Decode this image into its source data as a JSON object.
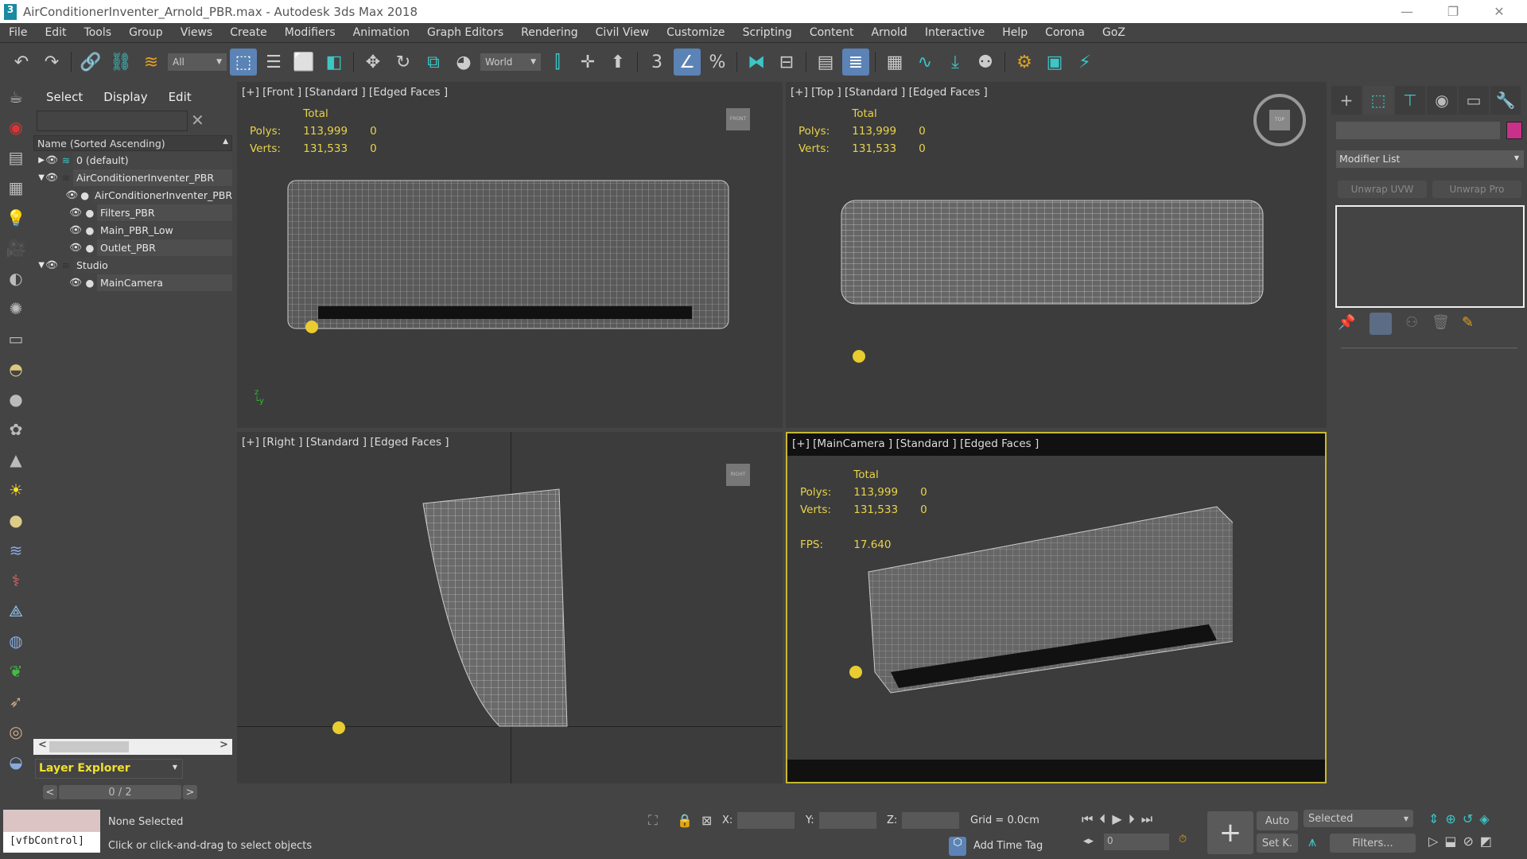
{
  "window": {
    "title": "AirConditionerInventer_Arnold_PBR.max - Autodesk 3ds Max 2018",
    "logo": "3",
    "minimize": "—",
    "restore": "❐",
    "close": "✕"
  },
  "menu": [
    "File",
    "Edit",
    "Tools",
    "Group",
    "Views",
    "Create",
    "Modifiers",
    "Animation",
    "Graph Editors",
    "Rendering",
    "Civil View",
    "Customize",
    "Scripting",
    "Content",
    "Arnold",
    "Interactive",
    "Help",
    "Corona",
    "GoZ"
  ],
  "toolbar": {
    "selection_filter": "All",
    "reference_coord": "World",
    "drop_arrow": "▼"
  },
  "explorer": {
    "tabs": [
      "Select",
      "Display",
      "Edit"
    ],
    "search_value": "",
    "clear": "✕",
    "column_header": "Name (Sorted Ascending)",
    "sort_arrow": "▲",
    "rows": [
      {
        "label": "0 (default)",
        "toggle": "▶",
        "indent": 0
      },
      {
        "label": "AirConditionerInventer_PBR",
        "toggle": "▼",
        "indent": 0
      },
      {
        "label": "AirConditionerInventer_PBR",
        "toggle": "",
        "indent": 1
      },
      {
        "label": "Filters_PBR",
        "toggle": "",
        "indent": 1
      },
      {
        "label": "Main_PBR_Low",
        "toggle": "",
        "indent": 1
      },
      {
        "label": "Outlet_PBR",
        "toggle": "",
        "indent": 1
      },
      {
        "label": "Studio",
        "toggle": "▼",
        "indent": 0
      },
      {
        "label": "MainCamera",
        "toggle": "",
        "indent": 1
      }
    ],
    "explorer_type": "Layer Explorer",
    "pager": "0 / 2",
    "prev": "<",
    "next": ">"
  },
  "viewports": [
    {
      "label": "[+] [Front ] [Standard ] [Edged Faces ]",
      "cube": "FRONT"
    },
    {
      "label": "[+] [Top ] [Standard ] [Edged Faces ]",
      "cube": "TOP"
    },
    {
      "label": "[+] [Right ] [Standard ] [Edged Faces ]",
      "cube": "RIGHT"
    },
    {
      "label": "[+] [MainCamera ] [Standard ] [Edged Faces ]"
    }
  ],
  "stats": {
    "total": "Total",
    "polys_label": "Polys:",
    "polys": "113,999",
    "polys_sel": "0",
    "verts_label": "Verts:",
    "verts": "131,533",
    "verts_sel": "0",
    "fps_label": "FPS:",
    "fps": "17.640"
  },
  "command_panel": {
    "modifier_list": "Modifier List",
    "unwrap_uvw": "Unwrap UVW",
    "unwrap_pro": "Unwrap Pro",
    "object_color": "#c8308a",
    "object_name": ""
  },
  "status": {
    "maxscript": "[vfbControl]",
    "selection": "None Selected",
    "prompt": "Click or click-and-drag to select objects",
    "x_label": "X:",
    "y_label": "Y:",
    "z_label": "Z:",
    "grid": "Grid = 0.0cm",
    "add_time_tag": "Add Time Tag",
    "auto": "Auto",
    "set_key": "Set K.",
    "key_filter": "Selected",
    "filters": "Filters...",
    "frame": "0"
  }
}
